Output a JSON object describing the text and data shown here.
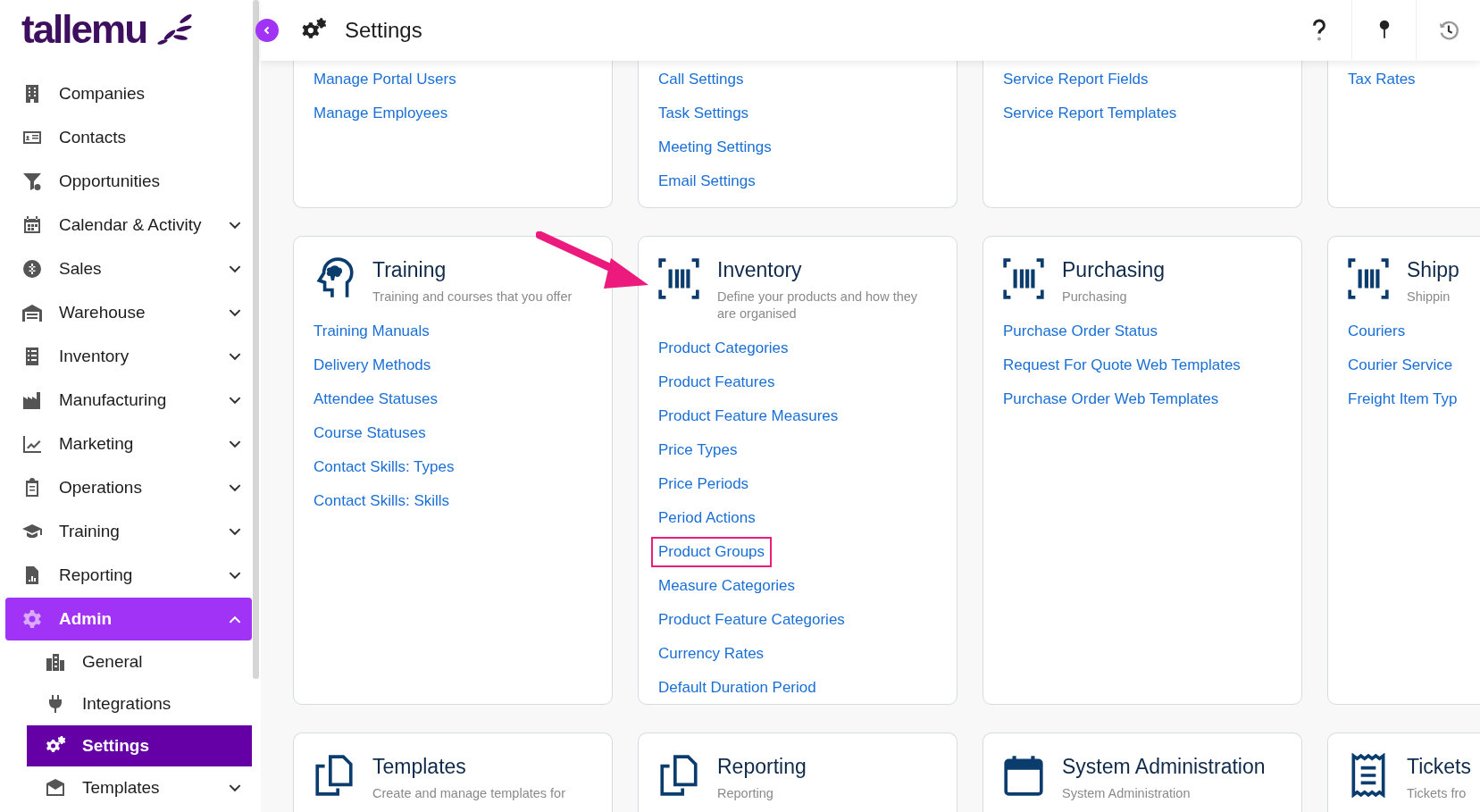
{
  "app": {
    "logo": "tallemu"
  },
  "sidebar": {
    "items": [
      {
        "label": "Companies",
        "kind": "link",
        "selected": false
      },
      {
        "label": "Contacts",
        "kind": "link",
        "selected": false
      },
      {
        "label": "Opportunities",
        "kind": "link",
        "selected": false
      },
      {
        "label": "Calendar & Activity",
        "kind": "group",
        "expanded": false,
        "selected": false
      },
      {
        "label": "Sales",
        "kind": "group",
        "expanded": false,
        "selected": false
      },
      {
        "label": "Warehouse",
        "kind": "group",
        "expanded": false,
        "selected": false
      },
      {
        "label": "Inventory",
        "kind": "group",
        "expanded": false,
        "selected": false
      },
      {
        "label": "Manufacturing",
        "kind": "group",
        "expanded": false,
        "selected": false
      },
      {
        "label": "Marketing",
        "kind": "group",
        "expanded": false,
        "selected": false
      },
      {
        "label": "Operations",
        "kind": "group",
        "expanded": false,
        "selected": false
      },
      {
        "label": "Training",
        "kind": "group",
        "expanded": false,
        "selected": false
      },
      {
        "label": "Reporting",
        "kind": "group",
        "expanded": false,
        "selected": false
      },
      {
        "label": "Admin",
        "kind": "group",
        "expanded": true,
        "selected": true,
        "children": [
          {
            "label": "General",
            "kind": "link",
            "selected": false
          },
          {
            "label": "Integrations",
            "kind": "link",
            "selected": false
          },
          {
            "label": "Settings",
            "kind": "link",
            "selected": true
          },
          {
            "label": "Templates",
            "kind": "group",
            "expanded": false,
            "selected": false
          }
        ]
      }
    ]
  },
  "header": {
    "title": "Settings"
  },
  "rows": [
    {
      "cards": [
        {
          "links": [
            {
              "label": "Manage Portal Users",
              "highlighted": false
            },
            {
              "label": "Manage Employees",
              "highlighted": false
            }
          ]
        },
        {
          "links": [
            {
              "label": "Call Settings",
              "highlighted": false
            },
            {
              "label": "Task Settings",
              "highlighted": false
            },
            {
              "label": "Meeting Settings",
              "highlighted": false
            },
            {
              "label": "Email Settings",
              "highlighted": false
            }
          ]
        },
        {
          "links": [
            {
              "label": "Service Report Fields",
              "highlighted": false
            },
            {
              "label": "Service Report Templates",
              "highlighted": false
            }
          ]
        },
        {
          "links": [
            {
              "label": "Tax Rates",
              "highlighted": false
            }
          ]
        }
      ]
    },
    {
      "cards": [
        {
          "title": "Training",
          "description": "Training and courses that you offer",
          "arrow": false,
          "links": [
            {
              "label": "Training Manuals",
              "highlighted": false
            },
            {
              "label": "Delivery Methods",
              "highlighted": false
            },
            {
              "label": "Attendee Statuses",
              "highlighted": false
            },
            {
              "label": "Course Statuses",
              "highlighted": false
            },
            {
              "label": "Contact Skills: Types",
              "highlighted": false
            },
            {
              "label": "Contact Skills: Skills",
              "highlighted": false
            }
          ]
        },
        {
          "title": "Inventory",
          "description": "Define your products and how they are organised",
          "arrow": true,
          "links": [
            {
              "label": "Product Categories",
              "highlighted": false
            },
            {
              "label": "Product Features",
              "highlighted": false
            },
            {
              "label": "Product Feature Measures",
              "highlighted": false
            },
            {
              "label": "Price Types",
              "highlighted": false
            },
            {
              "label": "Price Periods",
              "highlighted": false
            },
            {
              "label": "Period Actions",
              "highlighted": false
            },
            {
              "label": "Product Groups",
              "highlighted": true
            },
            {
              "label": "Measure Categories",
              "highlighted": false
            },
            {
              "label": "Product Feature Categories",
              "highlighted": false
            },
            {
              "label": "Currency Rates",
              "highlighted": false
            },
            {
              "label": "Default Duration Period",
              "highlighted": false
            }
          ]
        },
        {
          "title": "Purchasing",
          "description": "Purchasing",
          "arrow": false,
          "links": [
            {
              "label": "Purchase Order Status",
              "highlighted": false
            },
            {
              "label": "Request For Quote Web Templates",
              "highlighted": false
            },
            {
              "label": "Purchase Order Web Templates",
              "highlighted": false
            }
          ]
        },
        {
          "title": "Shipp",
          "description": "Shippin",
          "arrow": false,
          "links": [
            {
              "label": "Couriers",
              "highlighted": false
            },
            {
              "label": "Courier Service",
              "highlighted": false
            },
            {
              "label": "Freight Item Typ",
              "highlighted": false
            }
          ]
        }
      ]
    },
    {
      "cards": [
        {
          "title": "Templates",
          "description": "Create and manage templates for",
          "arrow": false
        },
        {
          "title": "Reporting",
          "description": "Reporting",
          "arrow": false
        },
        {
          "title": "System Administration",
          "description": "System Administration",
          "arrow": false
        },
        {
          "title": "Tickets",
          "description": "Tickets fro",
          "arrow": false
        }
      ]
    }
  ]
}
